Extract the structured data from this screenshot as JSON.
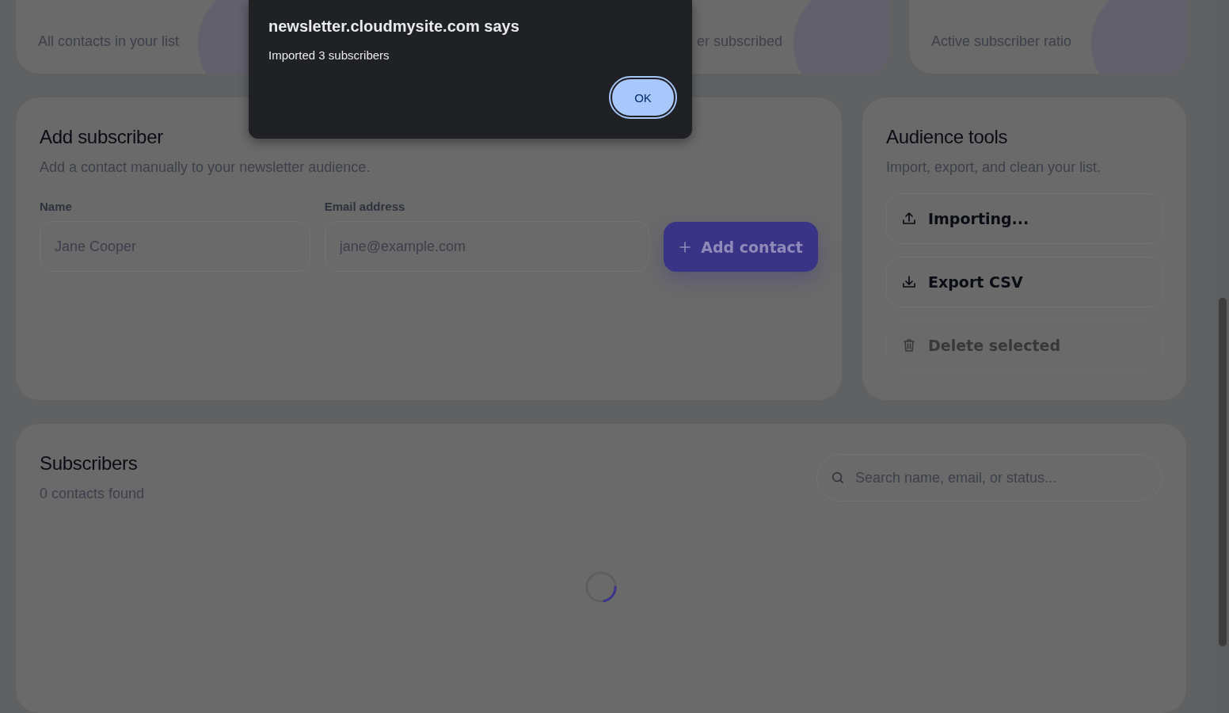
{
  "stats": [
    {
      "label": "All contacts in your list"
    },
    {
      "label": "er subscribed"
    },
    {
      "label": "Active subscriber ratio"
    }
  ],
  "add_subscriber": {
    "title": "Add subscriber",
    "subtitle": "Add a contact manually to your newsletter audience.",
    "fields": [
      {
        "label": "Name",
        "placeholder": "Jane Cooper"
      },
      {
        "label": "Email address",
        "placeholder": "jane@example.com"
      }
    ],
    "button": "Add contact"
  },
  "audience_tools": {
    "title": "Audience tools",
    "subtitle": "Import, export, and clean your list.",
    "actions": [
      {
        "label": "Importing...",
        "kind": "upload",
        "disabled": false
      },
      {
        "label": "Export CSV",
        "kind": "download",
        "disabled": false
      },
      {
        "label": "Delete selected",
        "kind": "trash",
        "disabled": true
      }
    ]
  },
  "subscribers": {
    "title": "Subscribers",
    "count": "0 contacts found",
    "search": {
      "placeholder": "Search name, email, or status..."
    },
    "loading": true
  },
  "dialog": {
    "title": "newsletter.cloudmysite.com says",
    "message": "Imported 3 subscribers",
    "button": "OK"
  }
}
